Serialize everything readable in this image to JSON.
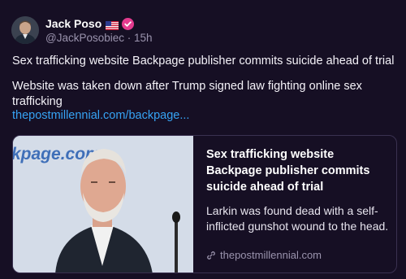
{
  "author": {
    "display_name": "Jack Poso",
    "handle": "@JackPosobiec",
    "separator": "·",
    "time_ago": "15h"
  },
  "post": {
    "headline": "Sex trafficking website Backpage publisher commits suicide ahead of trial",
    "subtext": "Website was taken down after Trump signed law fighting online sex trafficking",
    "link_text": "thepostmillennial.com/backpage..."
  },
  "card": {
    "image_text": "kpage.com",
    "title": "Sex trafficking website Backpage publisher commits suicide ahead of trial",
    "description": "Larkin was found dead with a self-inflicted gunshot wound to the head.",
    "domain": "thepostmillennial.com"
  },
  "colors": {
    "background": "#160f24",
    "link": "#36a3f4",
    "verified_badge": "#e43b8f",
    "muted_text": "#9a93ad"
  },
  "icons": [
    "us-flag-icon",
    "verified-badge-icon",
    "link-icon"
  ]
}
